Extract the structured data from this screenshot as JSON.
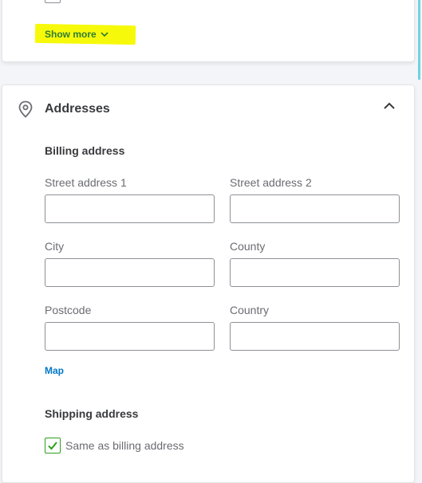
{
  "top_card": {
    "show_more_label": "Show more"
  },
  "addresses": {
    "title": "Addresses",
    "billing": {
      "title": "Billing address",
      "fields": {
        "street1": {
          "label": "Street address 1",
          "value": ""
        },
        "street2": {
          "label": "Street address 2",
          "value": ""
        },
        "city": {
          "label": "City",
          "value": ""
        },
        "county": {
          "label": "County",
          "value": ""
        },
        "postcode": {
          "label": "Postcode",
          "value": ""
        },
        "country": {
          "label": "Country",
          "value": ""
        }
      },
      "map_label": "Map"
    },
    "shipping": {
      "title": "Shipping address",
      "same_as_billing_label": "Same as billing address",
      "same_as_billing_checked": true
    }
  },
  "colors": {
    "accent_green": "#2ca01c",
    "link_blue": "#0077c5",
    "highlight_yellow": "#f7f90a",
    "text_dark": "#393a3d",
    "text_muted": "#6b6c72"
  }
}
